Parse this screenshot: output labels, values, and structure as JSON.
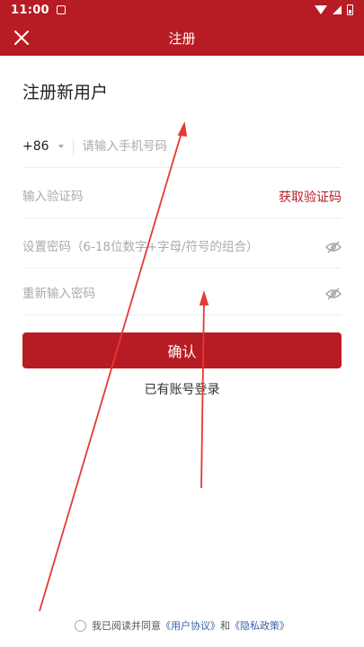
{
  "status_bar": {
    "time": "11:00"
  },
  "app_bar": {
    "title": "注册"
  },
  "page": {
    "heading": "注册新用户"
  },
  "form": {
    "country_code": "+86",
    "phone_placeholder": "请输入手机号码",
    "code_placeholder": "输入验证码",
    "get_code_label": "获取验证码",
    "password_placeholder": "设置密码（6-18位数字+字母/符号的组合）",
    "confirm_password_placeholder": "重新输入密码",
    "confirm_label": "确认",
    "login_link": "已有账号登录"
  },
  "agreement": {
    "prefix": "我已阅读并同意",
    "user_agreement": "《用户协议》",
    "conjunction": "和",
    "privacy_policy": "《隐私政策》"
  },
  "colors": {
    "brand": "#b71c24",
    "link": "#3b62a8",
    "annotation": "#e53935"
  }
}
